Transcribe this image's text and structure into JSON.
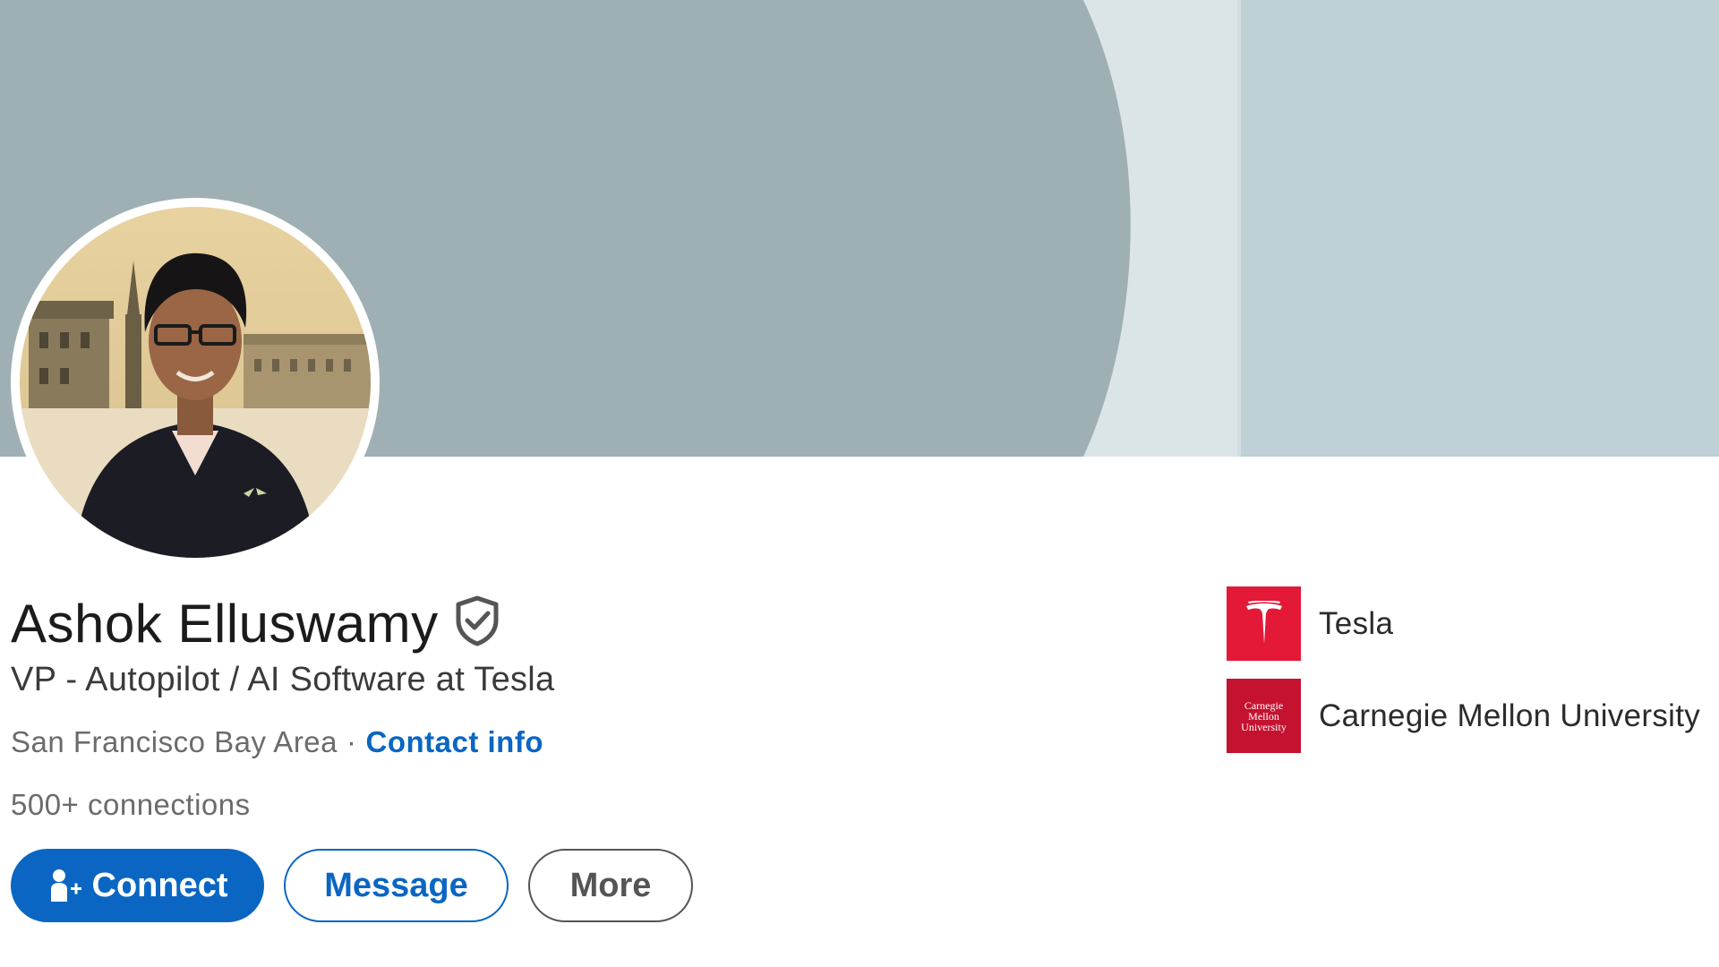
{
  "profile": {
    "name": "Ashok Elluswamy",
    "headline": "VP - Autopilot / AI Software at Tesla",
    "location": "San Francisco Bay Area",
    "separator": "·",
    "contact_info_label": "Contact info",
    "connections": "500+ connections",
    "verified_icon": "shield-check-icon"
  },
  "actions": {
    "connect_label": "Connect",
    "message_label": "Message",
    "more_label": "More"
  },
  "organizations": [
    {
      "name": "Tesla",
      "logo": "tesla-logo"
    },
    {
      "name": "Carnegie Mellon University",
      "logo": "cmu-logo",
      "logo_text": [
        "Carnegie",
        "Mellon",
        "University"
      ]
    }
  ],
  "colors": {
    "accent": "#0a66c2",
    "cover_dark": "#9fb0b5",
    "cover_light": "#bfd0d6",
    "tesla_red": "#e31937",
    "cmu_red": "#c41230"
  }
}
